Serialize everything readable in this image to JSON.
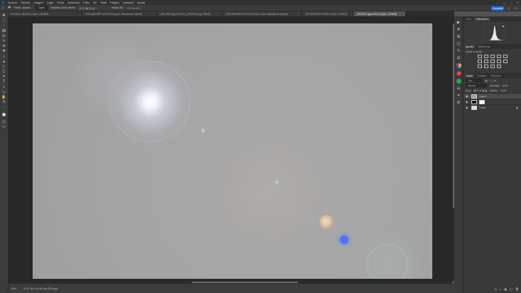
{
  "menubar": {
    "logo": "Ps",
    "items": [
      "Archivo",
      "Edición",
      "Imagen",
      "Capa",
      "Texto",
      "Selección",
      "Filtro",
      "3D",
      "Vista",
      "Plugins",
      "Ventana",
      "Ayuda"
    ],
    "window_controls": [
      "—",
      "□",
      "✕"
    ]
  },
  "options": {
    "home_icon": "home-icon",
    "tool_icon": "move-icon",
    "auto_select_label": "Selec. autom.:",
    "auto_select_value": "Capa",
    "transform_label": "Mostrar contr. transf.",
    "mode_3d": "Modo 3D:",
    "share_label": "Compartir"
  },
  "tabs": [
    {
      "label": "Sin título-1 @ 50% (Capa 1, RGB/8)",
      "active": false
    },
    {
      "label": "_DSC0000.NEF al 33,3% (Capa 0, Máscara de capa/8)",
      "active": false
    },
    {
      "label": "_DSC0001.jpg al 33,3% (_DSC0001.jpg, RGB/8)",
      "active": false
    },
    {
      "label": "_DSC0004.NEF al 33,3% (Fondo copia, Máscara de capa/8)",
      "active": false
    },
    {
      "label": "_DSC0026.NEF al 50% (Capa 1, RGB/8)",
      "active": false
    },
    {
      "label": "_DSC0027.jpg al 50% (Capa 1, RGB/8)",
      "active": true
    }
  ],
  "tools": [
    "✥",
    "⬚",
    "◌",
    "⌧",
    "⊡",
    "✎",
    "⊘",
    "✚",
    "⌕",
    "▲",
    "◐",
    "⬯",
    "✐",
    "T",
    "↖",
    "▭",
    "✋",
    "⚲",
    "⋯"
  ],
  "status": {
    "zoom": "50%",
    "doc_size": "40,07 cm x 26,69 cm (300 ppp)"
  },
  "right_icons": [
    "▶",
    "✜",
    "⊞",
    "◫",
    "✎",
    "⊟",
    "✿",
    "◎",
    "❖",
    "☰",
    "✦",
    "⚙"
  ],
  "histogram_panel": {
    "tabs": [
      "Color",
      "Histograma"
    ],
    "active_tab": "Histograma",
    "warning_icon": "warning-icon"
  },
  "adjustments_panel": {
    "tabs": [
      "Ajustes",
      "Bibliotecas"
    ],
    "active_tab": "Ajustes",
    "hint": "Añadir un ajuste"
  },
  "layers_panel": {
    "tabs": [
      "Capas",
      "Canales",
      "Trazados"
    ],
    "active_tab": "Capas",
    "filter": "Tipo",
    "blend_mode": "Normal",
    "opacity_label": "Opacidad:",
    "opacity_value": "100%",
    "lock_label": "Bloq.:",
    "fill_label": "Relleno:",
    "fill_value": "100%",
    "layers": [
      {
        "name": "Capa 1",
        "selected": true
      },
      {
        "name": "",
        "selected": false
      },
      {
        "name": "Fondo",
        "selected": false
      }
    ],
    "footer_icons": [
      "fx",
      "◐",
      "▣",
      "▢",
      "🗑"
    ]
  }
}
